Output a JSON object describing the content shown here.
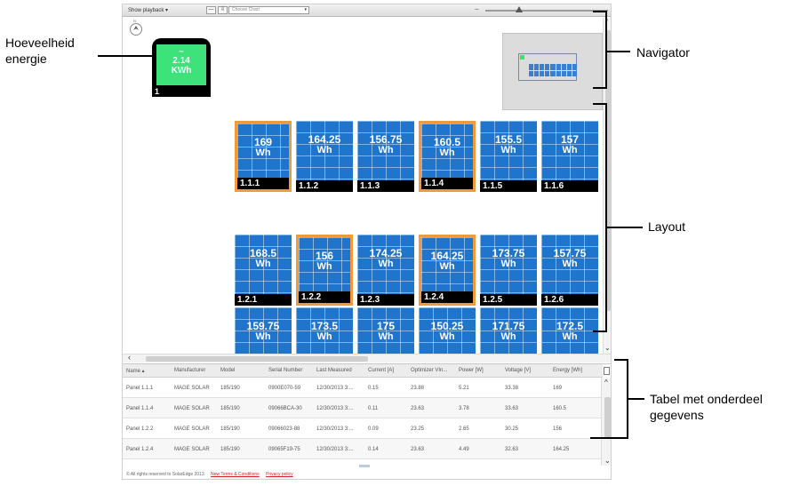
{
  "toolbar": {
    "playback_label": "Show playback",
    "playback_caret": "▾",
    "minus_label": "—",
    "download_label": "⇩",
    "chart_select_placeholder": "Choose Chart",
    "chart_select_caret": "▾"
  },
  "canvas": {
    "compass_symbol": "⮝",
    "compass_n": "N"
  },
  "energy_meter": {
    "icon": "sun-wave-icon",
    "icon_glyph": "~",
    "value": "2.14",
    "unit": "KWh",
    "index": "1"
  },
  "panels_rows": [
    [
      {
        "value": "169",
        "unit": "Wh",
        "id": "1.1.1",
        "selected": true
      },
      {
        "value": "164.25",
        "unit": "Wh",
        "id": "1.1.2",
        "selected": false
      },
      {
        "value": "156.75",
        "unit": "Wh",
        "id": "1.1.3",
        "selected": false
      },
      {
        "value": "160.5",
        "unit": "Wh",
        "id": "1.1.4",
        "selected": true
      },
      {
        "value": "155.5",
        "unit": "Wh",
        "id": "1.1.5",
        "selected": false
      },
      {
        "value": "157",
        "unit": "Wh",
        "id": "1.1.6",
        "selected": false
      }
    ],
    [
      {
        "value": "168.5",
        "unit": "Wh",
        "id": "1.2.1",
        "selected": false
      },
      {
        "value": "156",
        "unit": "Wh",
        "id": "1.2.2",
        "selected": true
      },
      {
        "value": "174.25",
        "unit": "Wh",
        "id": "1.2.3",
        "selected": false
      },
      {
        "value": "164.25",
        "unit": "Wh",
        "id": "1.2.4",
        "selected": true
      },
      {
        "value": "173.75",
        "unit": "Wh",
        "id": "1.2.5",
        "selected": false
      },
      {
        "value": "157.75",
        "unit": "Wh",
        "id": "1.2.6",
        "selected": false
      }
    ],
    [
      {
        "value": "159.75",
        "unit": "Wh",
        "id": "",
        "selected": false
      },
      {
        "value": "173.5",
        "unit": "Wh",
        "id": "",
        "selected": false
      },
      {
        "value": "175",
        "unit": "Wh",
        "id": "",
        "selected": false
      },
      {
        "value": "150.25",
        "unit": "Wh",
        "id": "",
        "selected": false
      },
      {
        "value": "171.75",
        "unit": "Wh",
        "id": "",
        "selected": false
      },
      {
        "value": "172.5",
        "unit": "Wh",
        "id": "",
        "selected": false
      }
    ]
  ],
  "table": {
    "columns": [
      "Name ▴",
      "Manufacturer",
      "Model",
      "Serial Number",
      "Last Measured",
      "Current [A]",
      "Optimizer VIn...",
      "Power [W]",
      "Voltage [V]",
      "Energy [Wh]"
    ],
    "rows": [
      [
        "Panel 1.1.1",
        "MAGE SOLAR",
        "185/190",
        "0900E070-59",
        "12/30/2013 3:...",
        "0.15",
        "23.88",
        "5.21",
        "33.38",
        "169"
      ],
      [
        "Panel 1.1.4",
        "MAGE SOLAR",
        "185/190",
        "09066BCA-30",
        "12/30/2013 3:...",
        "0.11",
        "23.63",
        "3.78",
        "33.63",
        "160.5"
      ],
      [
        "Panel 1.2.2",
        "MAGE SOLAR",
        "185/190",
        "09066023-88",
        "12/30/2013 3:...",
        "0.09",
        "23.25",
        "2.65",
        "30.25",
        "156"
      ],
      [
        "Panel 1.2.4",
        "MAGE SOLAR",
        "185/190",
        "09065F19-75",
        "12/30/2013 3:...",
        "0.14",
        "23.63",
        "4.49",
        "32.63",
        "164.25"
      ]
    ]
  },
  "footer": {
    "copyright": "© All rights reserved to SolarEdge 2013",
    "terms_link": "New Terms & Conditions",
    "privacy_link": "Privacy policy"
  },
  "annotations": {
    "energy_line1": "Hoeveelheid",
    "energy_line2": "energie",
    "navigator": "Navigator",
    "layout": "Layout",
    "table_line1": "Tabel met onderdeel",
    "table_line2": "gegevens"
  },
  "colors": {
    "panel_blue": "#1f74cc",
    "selected_border": "#f29a38",
    "meter_green": "#3ee27a",
    "link_red": "#d62222"
  }
}
